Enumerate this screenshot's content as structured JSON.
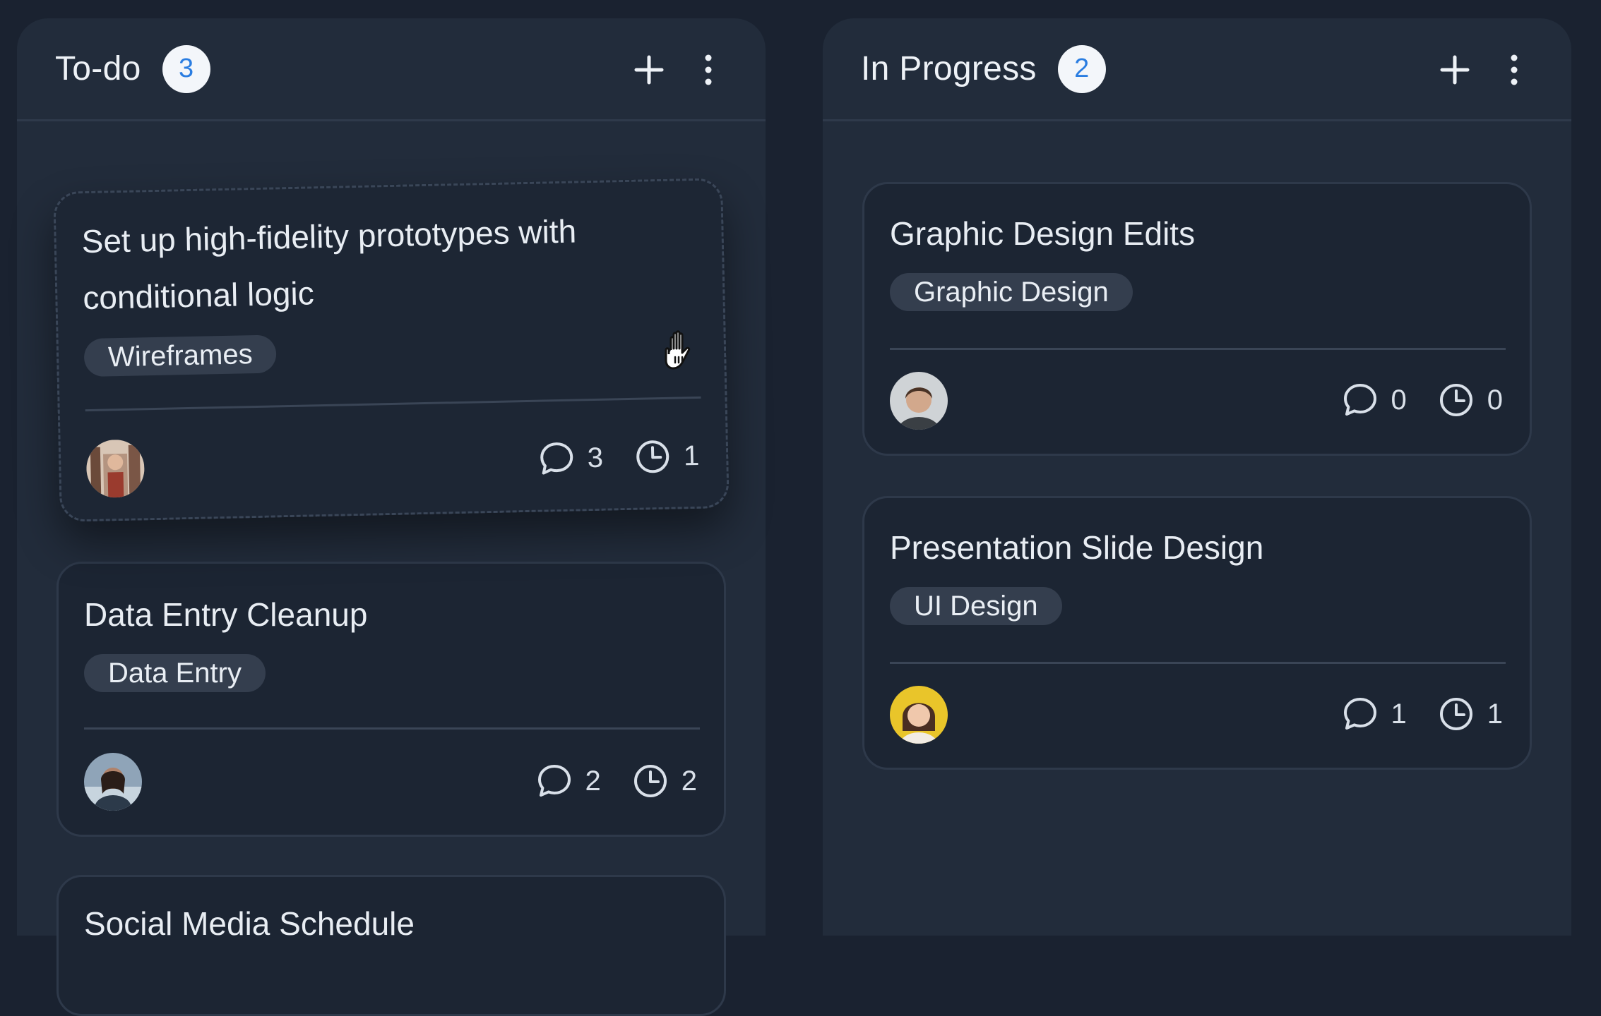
{
  "columns": {
    "todo": {
      "title": "To-do",
      "count": "3",
      "cards": [
        {
          "title_line1": "Set up high-fidelity prototypes with",
          "title_line2": "conditional logic",
          "tag": "Wireframes",
          "comments": "3",
          "time": "1"
        },
        {
          "title": "Data Entry Cleanup",
          "tag": "Data Entry",
          "comments": "2",
          "time": "2"
        },
        {
          "title": "Social Media Schedule"
        }
      ]
    },
    "in_progress": {
      "title": "In Progress",
      "count": "2",
      "cards": [
        {
          "title": "Graphic Design Edits",
          "tag": "Graphic Design",
          "comments": "0",
          "time": "0"
        },
        {
          "title": "Presentation Slide Design",
          "tag": "UI Design",
          "comments": "1",
          "time": "1"
        }
      ]
    }
  },
  "colors": {
    "background": "#1a2230",
    "column": "#222c3b",
    "card": "#1c2533",
    "badge_text": "#2a7de1"
  }
}
